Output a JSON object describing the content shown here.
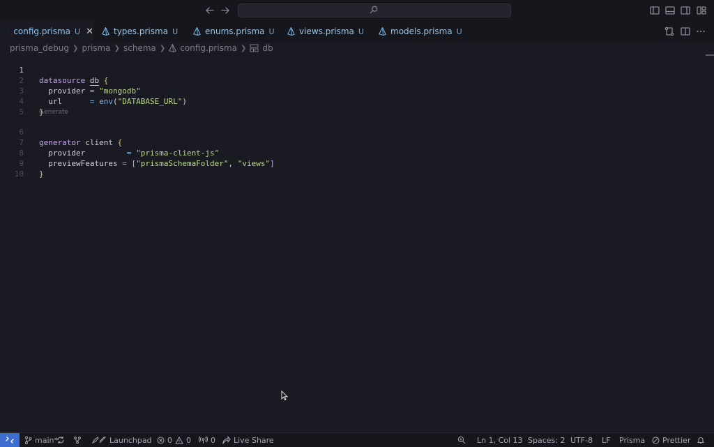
{
  "search": {
    "placeholder": ""
  },
  "tabs": [
    {
      "label": "config.prisma",
      "status": "U",
      "active": true
    },
    {
      "label": "types.prisma",
      "status": "U"
    },
    {
      "label": "enums.prisma",
      "status": "U"
    },
    {
      "label": "views.prisma",
      "status": "U"
    },
    {
      "label": "models.prisma",
      "status": "U"
    }
  ],
  "breadcrumb": [
    "prisma_debug",
    "prisma",
    "schema",
    "config.prisma",
    "db"
  ],
  "editor": {
    "line_numbers": [
      "1",
      "2",
      "3",
      "4",
      "5",
      "6",
      "7",
      "8",
      "9",
      "10"
    ],
    "codelens": "Generate",
    "tokens": {
      "l1_kw": "datasource",
      "l1_name": "db",
      "l1_brace": "{",
      "l2_key": "provider",
      "l2_eq": "=",
      "l2_val": "\"mongodb\"",
      "l3_key": "url",
      "l3_eq": "=",
      "l3_fn": "env",
      "l3_po": "(",
      "l3_val": "\"DATABASE_URL\"",
      "l3_pc": ")",
      "l4_brace": "}",
      "l6_kw": "generator",
      "l6_name": "client",
      "l6_brace": "{",
      "l7_key": "provider",
      "l7_eq": "=",
      "l7_val": "\"prisma-client-js\"",
      "l8_key": "previewFeatures",
      "l8_eq": "=",
      "l8_bo": "[",
      "l8_v1": "\"prismaSchemaFolder\"",
      "l8_comma": ",",
      "l8_v2": "\"views\"",
      "l8_bc": "]",
      "l9_brace": "}"
    }
  },
  "statusbar": {
    "branch": "main*",
    "launchpad": "Launchpad",
    "errors": "0",
    "warnings": "0",
    "ports": "0",
    "live_share": "Live Share",
    "position": "Ln 1, Col 13",
    "spaces": "Spaces: 2",
    "encoding": "UTF-8",
    "eol": "LF",
    "language": "Prisma",
    "formatter": "Prettier"
  },
  "colors": {
    "accent": "#3d6ecf",
    "tab_active_text": "#8fc4ea",
    "string": "#b9d98a",
    "keyword": "#c3a6e8"
  }
}
